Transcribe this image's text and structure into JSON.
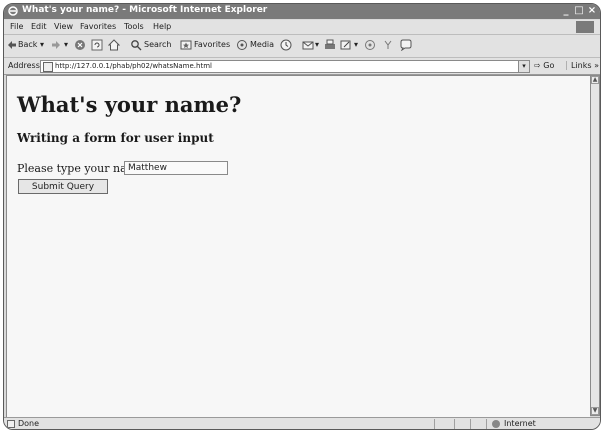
{
  "window": {
    "title": "What's your name? - Microsoft Internet Explorer",
    "controls": [
      "_",
      "□",
      "×"
    ]
  },
  "menu": {
    "items": [
      "File",
      "Edit",
      "View",
      "Favorites",
      "Tools",
      "Help"
    ]
  },
  "toolbar": {
    "back_label": "Back",
    "search_label": "Search",
    "favorites_label": "Favorites",
    "media_label": "Media"
  },
  "address": {
    "label": "Address",
    "url": "http://127.0.0.1/phab/ph02/whatsName.html",
    "go_label": "Go",
    "links_label": "Links"
  },
  "page": {
    "heading": "What's your name?",
    "subheading": "Writing a form for user input",
    "prompt_label": "Please type your name:",
    "name_value": "Matthew",
    "submit_label": "Submit Query"
  },
  "status": {
    "text": "Done",
    "zone": "Internet"
  }
}
